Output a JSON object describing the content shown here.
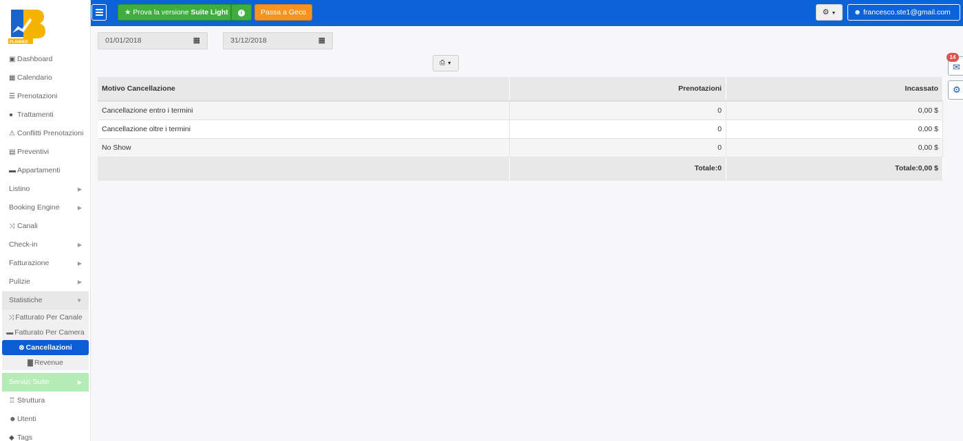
{
  "logo": {
    "text": "PLANNER"
  },
  "sidebar": {
    "items": [
      {
        "label": "Dashboard",
        "icon": "monitor-icon",
        "glyph": "▣"
      },
      {
        "label": "Calendario",
        "icon": "calendar-icon",
        "glyph": "▦"
      },
      {
        "label": "Prenotazioni",
        "icon": "list-icon",
        "glyph": "☰"
      },
      {
        "label": "Trattamenti",
        "icon": "apple-icon",
        "glyph": "●"
      },
      {
        "label": "Conflitti Prenotazioni",
        "icon": "warning-icon",
        "glyph": "⚠"
      },
      {
        "label": "Preventivi",
        "icon": "document-icon",
        "glyph": "▤"
      },
      {
        "label": "Appartamenti",
        "icon": "bed-icon",
        "glyph": "▬"
      },
      {
        "label": "Listino",
        "caret": true
      },
      {
        "label": "Booking Engine",
        "caret": true
      },
      {
        "label": "Canali",
        "icon": "shuffle-icon",
        "glyph": "⤨"
      },
      {
        "label": "Check-in",
        "caret": true
      },
      {
        "label": "Fatturazione",
        "caret": true
      },
      {
        "label": "Pulizie",
        "caret": true
      }
    ],
    "statistiche": {
      "label": "Statistiche",
      "sub": [
        {
          "label": "Fatturato Per Canale",
          "icon": "shuffle-icon",
          "glyph": "⤨"
        },
        {
          "label": "Fatturato Per Camera",
          "icon": "bed-icon",
          "glyph": "▬"
        },
        {
          "label": "Cancellazioni",
          "icon": "cancel-circle-icon",
          "glyph": "⊗"
        },
        {
          "label": "Revenue",
          "icon": "bar-chart-icon",
          "glyph": "▇"
        }
      ]
    },
    "servizi_suite": {
      "label": "Servizi Suite"
    },
    "bottom": [
      {
        "label": "Struttura",
        "icon": "building-icon",
        "glyph": "♖"
      },
      {
        "label": "Utenti",
        "icon": "user-icon",
        "glyph": "☻"
      },
      {
        "label": "Tags",
        "icon": "tags-icon",
        "glyph": "◆"
      }
    ]
  },
  "topbar": {
    "suite_prefix": "Prova la versione ",
    "suite_bold": "Suite Light",
    "geco_label": "Passa a Geco",
    "user_email": "francesco.ste1@gmail.com"
  },
  "filters": {
    "date_from": "01/01/2018",
    "date_to": "31/12/2018"
  },
  "table": {
    "headers": [
      "Motivo Cancellazione",
      "Prenotazioni",
      "Incassato"
    ],
    "rows": [
      [
        "Cancellazione entro i termini",
        "0",
        "0,00 $"
      ],
      [
        "Cancellazione oltre i termini",
        "0",
        "0,00 $"
      ],
      [
        "No Show",
        "0",
        "0,00 $"
      ]
    ],
    "total_prenotazioni": "Totale:0",
    "total_incassato": "Totale:0,00 $"
  },
  "widgets": {
    "mail_badge": "14"
  },
  "colors": {
    "topbar": "#0c63d8",
    "green": "#3fae3f",
    "orange": "#f7931e",
    "active": "#0b5cd5",
    "badge": "#d9534f"
  }
}
